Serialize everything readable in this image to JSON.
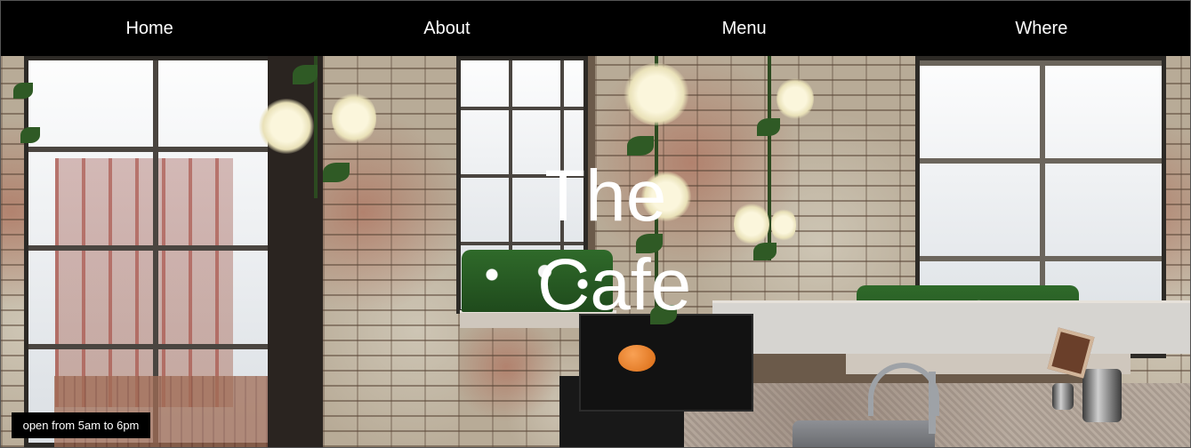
{
  "nav": {
    "items": [
      {
        "label": "Home"
      },
      {
        "label": "About"
      },
      {
        "label": "Menu"
      },
      {
        "label": "Where"
      }
    ]
  },
  "hero": {
    "title_line1": "The",
    "title_line2": "Cafe",
    "image_description_icon": "cafe-interior-photo"
  },
  "hours": {
    "text": "open from 5am to 6pm"
  },
  "colors": {
    "nav_background": "#000000",
    "nav_text": "#ffffff",
    "title_text": "#ffffff",
    "badge_background": "#000000"
  }
}
